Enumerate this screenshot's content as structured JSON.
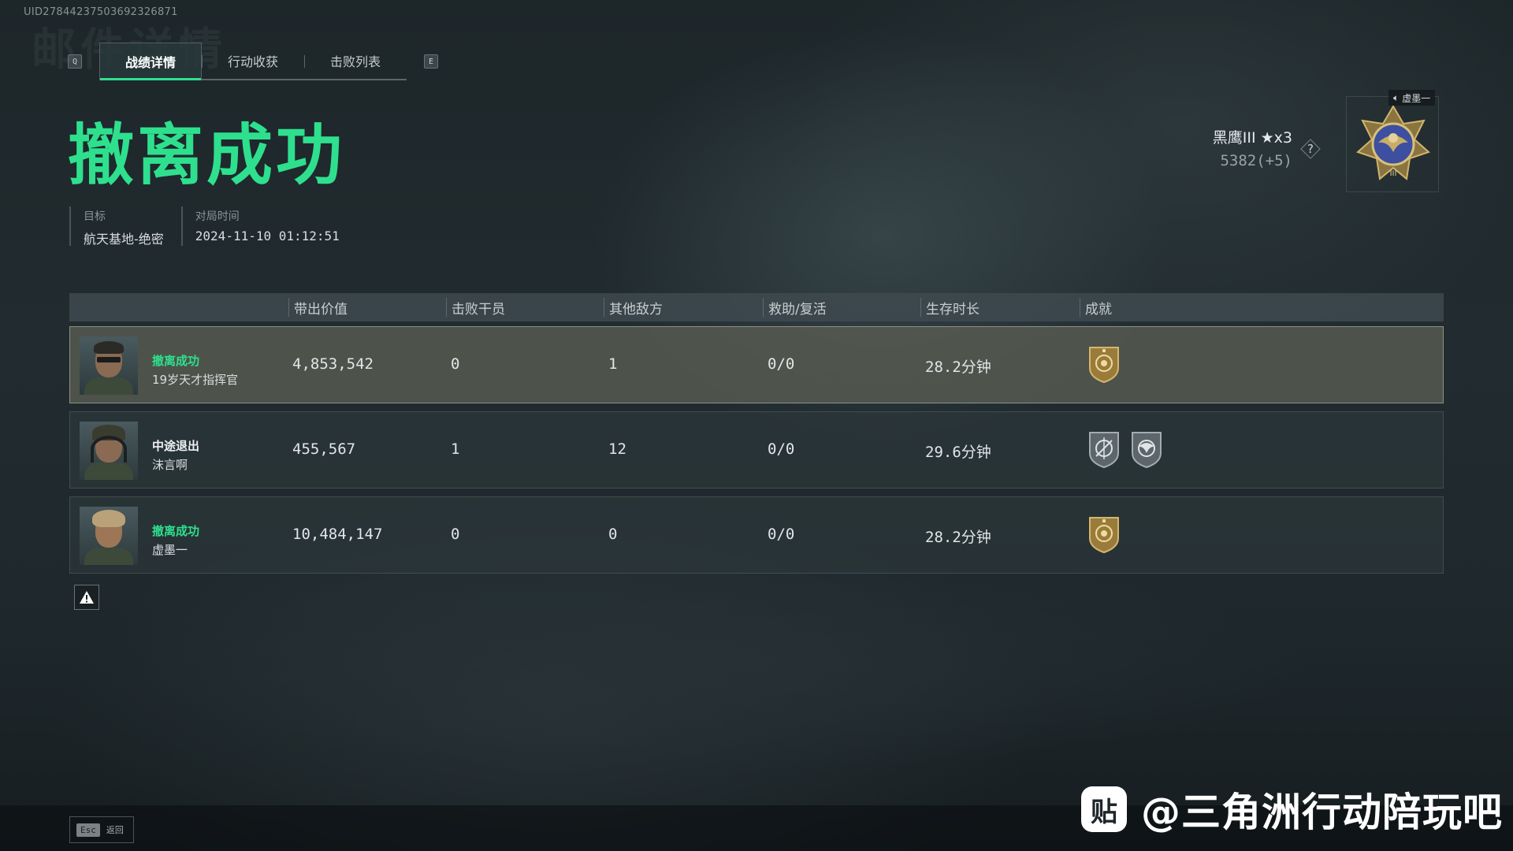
{
  "uid": "UID27844237503692326871",
  "ghost_title": "邮件详情",
  "tabs": {
    "left_key": "Q",
    "right_key": "E",
    "items": [
      {
        "label": "战绩详情",
        "active": true
      },
      {
        "label": "行动收获",
        "active": false
      },
      {
        "label": "击败列表",
        "active": false
      }
    ]
  },
  "result_title": "撤离成功",
  "meta": {
    "target_label": "目标",
    "target_value": "航天基地-绝密",
    "time_label": "对局时间",
    "time_value": "2024-11-10 01:12:51"
  },
  "rank": {
    "name": "黑鹰III ★x3",
    "points": "5382(+5)",
    "help": "?",
    "voice_tag": "虚墨一"
  },
  "table": {
    "columns": [
      "带出价值",
      "击败干员",
      "其他敌方",
      "救助/复活",
      "生存时长",
      "成就"
    ],
    "rows": [
      {
        "status": "撤离成功",
        "status_color": "#2ee08e",
        "name": "19岁天才指挥官",
        "value": "4,853,542",
        "defeated": "0",
        "other": "1",
        "assist": "0/0",
        "survival": "28.2分钟",
        "achievements": [
          "gold-shield"
        ],
        "highlight": true
      },
      {
        "status": "中途退出",
        "status_color": "#eef1f2",
        "name": "沫言啊",
        "value": "455,567",
        "defeated": "1",
        "other": "12",
        "assist": "0/0",
        "survival": "29.6分钟",
        "achievements": [
          "silver-crosshair",
          "silver-eagle"
        ],
        "highlight": false
      },
      {
        "status": "撤离成功",
        "status_color": "#2ee08e",
        "name": "虚墨一",
        "value": "10,484,147",
        "defeated": "0",
        "other": "0",
        "assist": "0/0",
        "survival": "28.2分钟",
        "achievements": [
          "gold-shield"
        ],
        "highlight": false
      }
    ]
  },
  "footer": {
    "esc_key": "Esc",
    "esc_label": "返回"
  },
  "watermark": {
    "logo": "贴",
    "text": "@三角洲行动陪玩吧"
  },
  "colors": {
    "accent_green": "#2ee08e",
    "gold": "#b8963e",
    "silver": "#8e989c"
  }
}
